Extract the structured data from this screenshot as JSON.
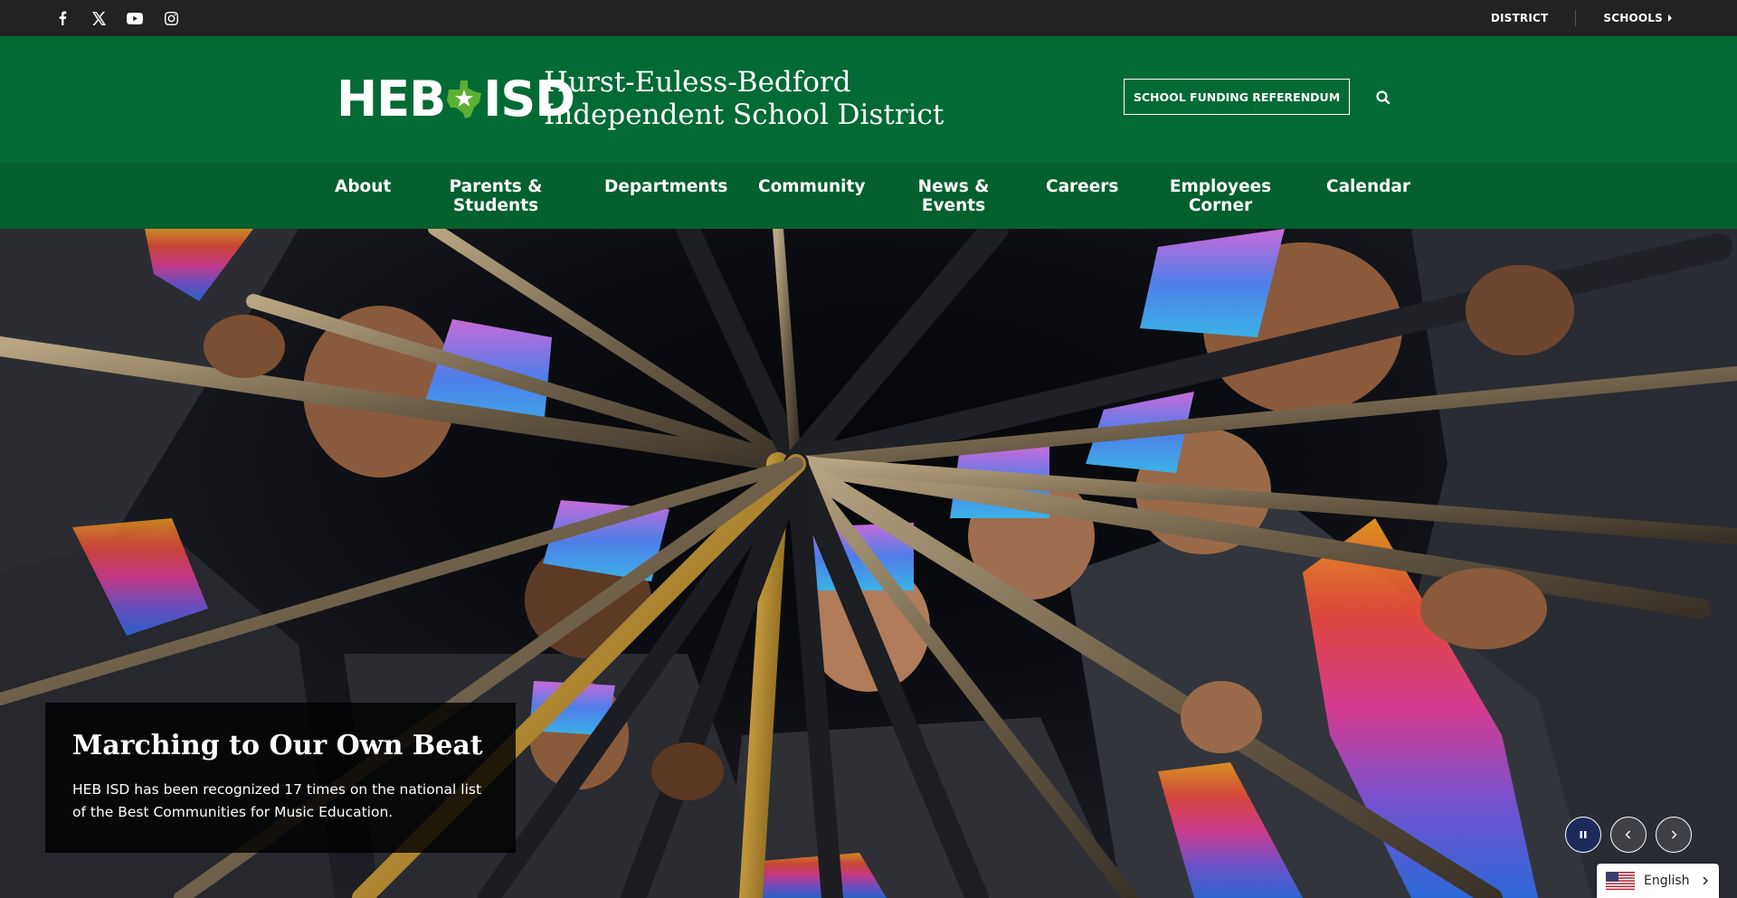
{
  "topbar": {
    "social": [
      {
        "icon": "facebook-icon"
      },
      {
        "icon": "x-twitter-icon"
      },
      {
        "icon": "youtube-icon"
      },
      {
        "icon": "instagram-icon"
      }
    ],
    "links": {
      "district": "DISTRICT",
      "schools": "SCHOOLS"
    }
  },
  "header": {
    "logo": {
      "left": "HEB",
      "right": "ISD"
    },
    "district_name": "Hurst-Euless-Bedford Independent School District",
    "referendum_label": "SCHOOL FUNDING REFERENDUM",
    "search_icon": "search-icon"
  },
  "nav": {
    "about": "About",
    "parents": "Parents & Students",
    "departments": "Departments",
    "community": "Community",
    "news": "News & Events",
    "careers": "Careers",
    "employees": "Employees Corner",
    "calendar": "Calendar"
  },
  "hero": {
    "title": "Marching to Our Own Beat",
    "text": "HEB ISD has been recognized 17 times on the national list of the Best Communities for Music Education."
  },
  "language": {
    "label": "English"
  },
  "colors": {
    "brand_green": "#036a36",
    "nav_green": "#04602f",
    "topbar": "#222222"
  }
}
